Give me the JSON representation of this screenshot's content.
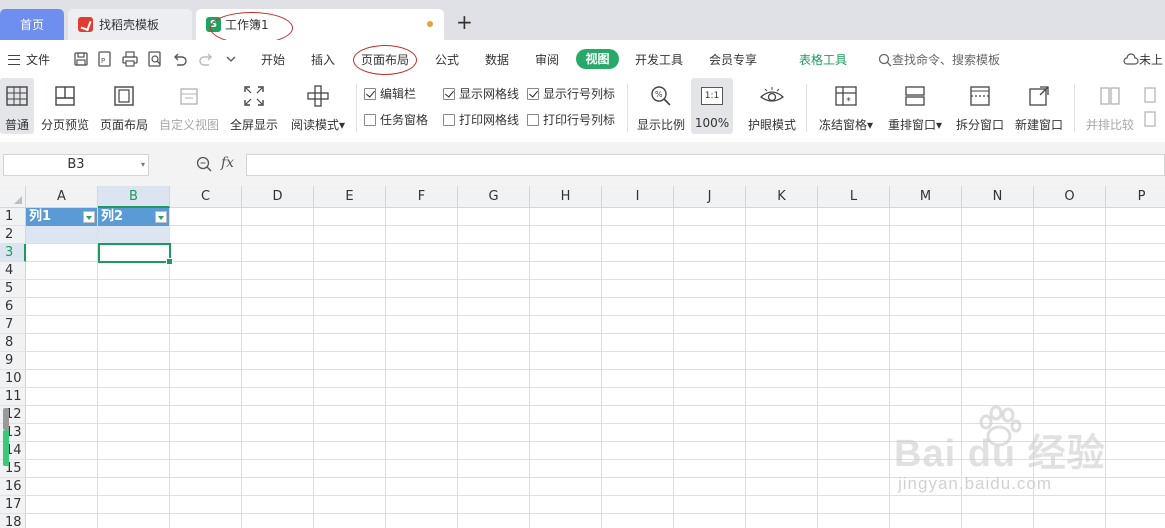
{
  "tabs": {
    "home": "首页",
    "daoke": "找稻壳模板",
    "workbook": "工作簿1",
    "add": "+"
  },
  "menu": {
    "file": "文件",
    "items": [
      "开始",
      "插入",
      "页面布局",
      "公式",
      "数据",
      "审阅",
      "视图",
      "开发工具",
      "会员专享",
      "表格工具"
    ],
    "active": "视图",
    "search_placeholder": "查找命令、搜索模板",
    "right_label": "未上"
  },
  "ribbon": {
    "normal": "普通",
    "page_break_preview": "分页预览",
    "page_layout": "页面布局",
    "custom_view": "自定义视图",
    "full_screen": "全屏显示",
    "reading_mode": "阅读模式",
    "chk_formula_bar": "编辑栏",
    "chk_task_pane": "任务窗格",
    "chk_show_gridlines": "显示网格线",
    "chk_print_gridlines": "打印网格线",
    "chk_show_headings": "显示行号列标",
    "chk_print_headings": "打印行号列标",
    "zoom_ratio": "显示比例",
    "zoom_100_label": "100%",
    "zoom_100_icon": "1:1",
    "eye_mode": "护眼模式",
    "freeze_panes": "冻结窗格",
    "arrange_windows": "重排窗口",
    "split_window": "拆分窗口",
    "new_window": "新建窗口",
    "compare_side": "并排比较",
    "checks": {
      "formula_bar": true,
      "task_pane": false,
      "show_gridlines": true,
      "print_gridlines": false,
      "show_headings": true,
      "print_headings": false
    }
  },
  "formula_bar": {
    "name_box": "B3",
    "fx": "fx",
    "value": ""
  },
  "sheet": {
    "columns": [
      "A",
      "B",
      "C",
      "D",
      "E",
      "F",
      "G",
      "H",
      "I",
      "J",
      "K",
      "L",
      "M",
      "N",
      "O",
      "P"
    ],
    "rows": [
      "1",
      "2",
      "3",
      "4",
      "5",
      "6",
      "7",
      "8",
      "9",
      "10",
      "11",
      "12",
      "13",
      "14",
      "15",
      "16",
      "17",
      "18"
    ],
    "table_headers": [
      "列1",
      "列2"
    ],
    "selected_cell": "B3",
    "selected_column": "B",
    "selected_row": "3"
  },
  "watermark": {
    "main": "Bai du 经验",
    "sub": "jingyan.baidu.com"
  },
  "colors": {
    "accent_green": "#28a96a",
    "table_header_blue": "#5b9bd5",
    "table_band": "#dce6f2",
    "home_tab": "#6e8ef0"
  }
}
